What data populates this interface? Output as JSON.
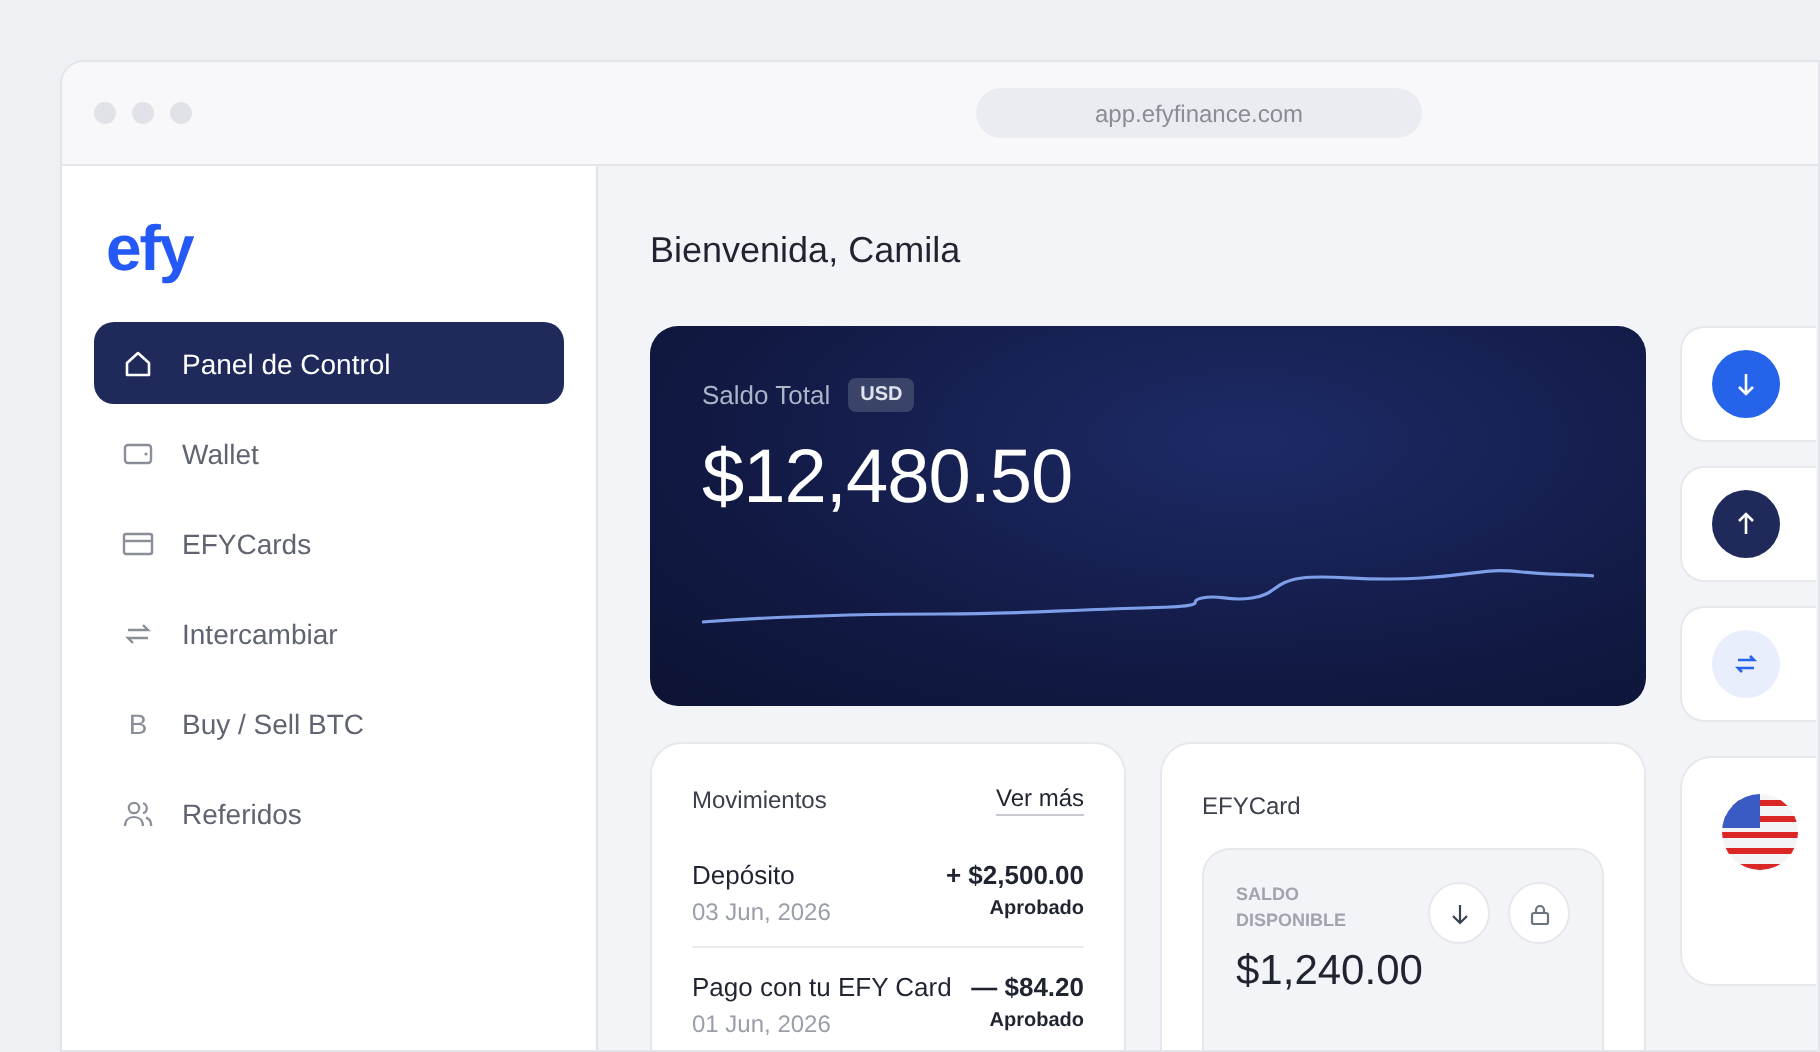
{
  "browser": {
    "url": "app.efyfinance.com"
  },
  "sidebar": {
    "logo": "efy",
    "items": [
      {
        "label": "Panel de Control",
        "kind": "home",
        "selected": true
      },
      {
        "label": "Wallet",
        "kind": "wallet",
        "selected": false
      },
      {
        "label": "EFYCards",
        "kind": "card",
        "selected": false
      },
      {
        "label": "Intercambiar",
        "kind": "swap",
        "selected": false
      },
      {
        "label": "Buy / Sell BTC",
        "kind": "btc",
        "glyph": "B",
        "selected": false
      },
      {
        "label": "Referidos",
        "kind": "users",
        "selected": false
      }
    ]
  },
  "greeting": "Bienvenida, Camila",
  "balance_card": {
    "label": "Saldo Total",
    "currency": "USD",
    "amount": "$12,480.50"
  },
  "quick_actions": [
    {
      "kind": "receive"
    },
    {
      "kind": "send"
    },
    {
      "kind": "exchange"
    }
  ],
  "movements": {
    "title": "Movimientos",
    "link": "Ver más",
    "rows": [
      {
        "name": "Depósito",
        "date": "03 Jun, 2026",
        "amount": "+ $2,500.00",
        "status": "Aprobado"
      },
      {
        "name": "Pago con tu EFY Card",
        "date": "01 Jun, 2026",
        "amount": "— $84.20",
        "status": "Aprobado"
      }
    ]
  },
  "efy_card": {
    "title": "EFYCard",
    "balance_label": "SALDO DISPONIBLE",
    "balance": "$1,240.00"
  }
}
